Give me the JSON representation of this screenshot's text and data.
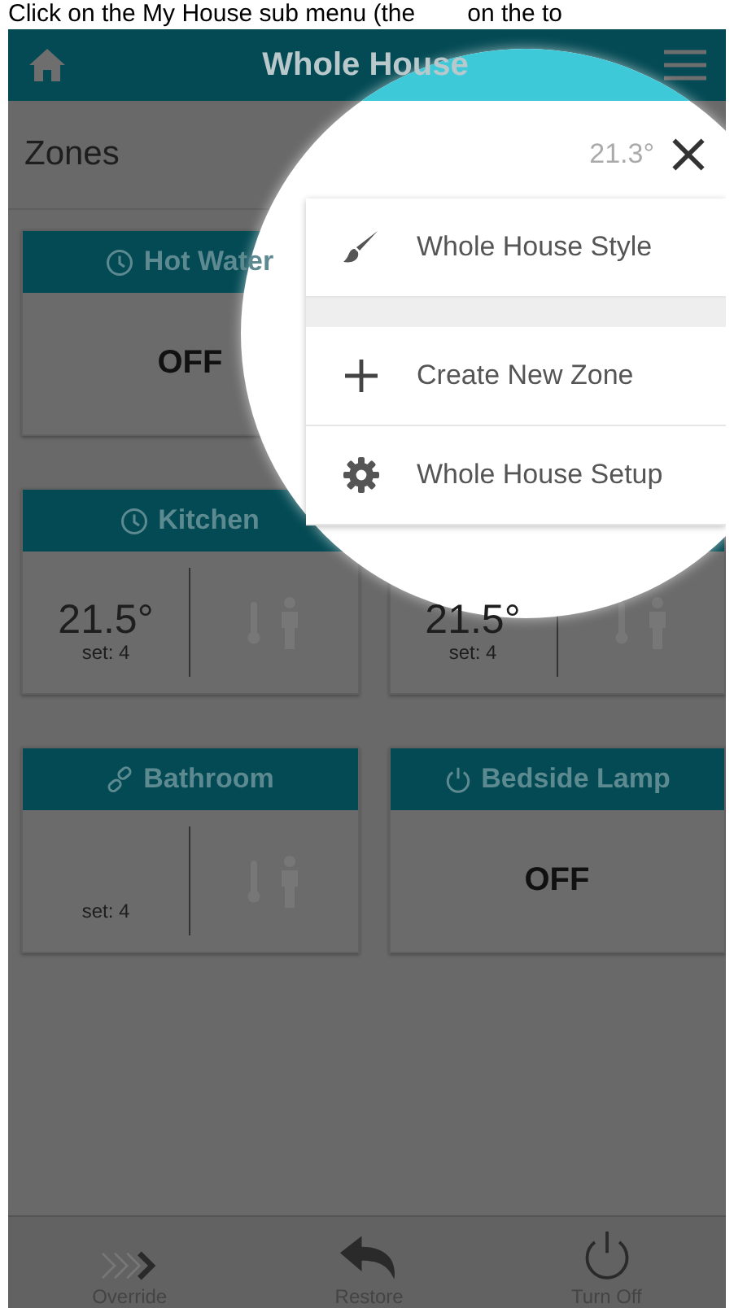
{
  "caption": {
    "before": "Click on the My House sub menu (the",
    "after": "on the to"
  },
  "header": {
    "title": "Whole House"
  },
  "zones": {
    "title": "Zones",
    "temperature": "21.3°"
  },
  "menu": [
    {
      "kind": "style",
      "label": "Whole House Style"
    },
    {
      "kind": "create",
      "label": "Create New Zone"
    },
    {
      "kind": "setup",
      "label": "Whole House Setup"
    }
  ],
  "cards": [
    {
      "kind": "status",
      "head": {
        "kind": "clock",
        "label": "Hot Water"
      },
      "status": "OFF"
    },
    {
      "kind": "blank"
    },
    {
      "kind": "thermostat",
      "head": {
        "kind": "clock",
        "label": "Kitchen"
      },
      "temperature": "21.5°",
      "setpoint": "set: 4"
    },
    {
      "kind": "thermostat",
      "temperature": "21.5°",
      "setpoint": "set: 4"
    },
    {
      "kind": "thermostat",
      "head": {
        "kind": "link",
        "label": "Bathroom"
      },
      "setpoint": "set: 4"
    },
    {
      "kind": "status",
      "head": {
        "kind": "power",
        "label": "Bedside Lamp"
      },
      "status": "OFF"
    }
  ],
  "nav": [
    {
      "kind": "override",
      "label": "Override"
    },
    {
      "kind": "restore",
      "label": "Restore"
    },
    {
      "kind": "off",
      "label": "Turn Off"
    }
  ]
}
